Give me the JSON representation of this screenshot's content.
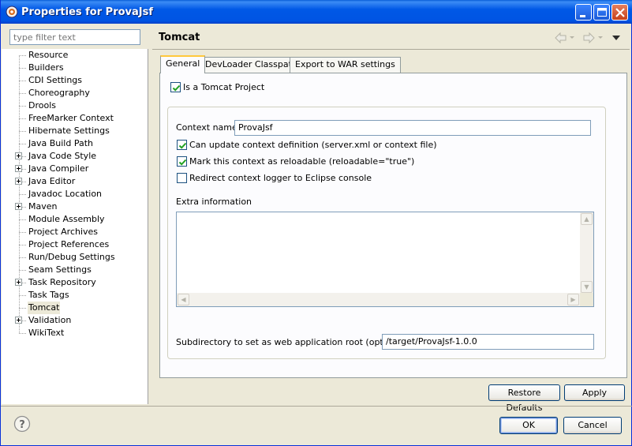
{
  "window": {
    "title": "Properties for ProvaJsf",
    "minimize_icon": "minimize-icon",
    "maximize_icon": "maximize-icon",
    "close_icon": "close-icon"
  },
  "filter": {
    "placeholder": "type filter text"
  },
  "tree": {
    "items": [
      {
        "label": "Resource",
        "expandable": false
      },
      {
        "label": "Builders",
        "expandable": false
      },
      {
        "label": "CDI Settings",
        "expandable": false
      },
      {
        "label": "Choreography",
        "expandable": false
      },
      {
        "label": "Drools",
        "expandable": false
      },
      {
        "label": "FreeMarker Context",
        "expandable": false
      },
      {
        "label": "Hibernate Settings",
        "expandable": false
      },
      {
        "label": "Java Build Path",
        "expandable": false
      },
      {
        "label": "Java Code Style",
        "expandable": true
      },
      {
        "label": "Java Compiler",
        "expandable": true
      },
      {
        "label": "Java Editor",
        "expandable": true
      },
      {
        "label": "Javadoc Location",
        "expandable": false
      },
      {
        "label": "Maven",
        "expandable": true
      },
      {
        "label": "Module Assembly",
        "expandable": false
      },
      {
        "label": "Project Archives",
        "expandable": false
      },
      {
        "label": "Project References",
        "expandable": false
      },
      {
        "label": "Run/Debug Settings",
        "expandable": false
      },
      {
        "label": "Seam Settings",
        "expandable": false
      },
      {
        "label": "Task Repository",
        "expandable": true
      },
      {
        "label": "Task Tags",
        "expandable": false
      },
      {
        "label": "Tomcat",
        "expandable": false,
        "selected": true
      },
      {
        "label": "Validation",
        "expandable": true
      },
      {
        "label": "WikiText",
        "expandable": false
      }
    ]
  },
  "page": {
    "title": "Tomcat",
    "nav_icons": [
      "back-arrow-icon",
      "forward-arrow-icon",
      "view-menu-icon"
    ]
  },
  "tabs": [
    {
      "label": "General",
      "active": true
    },
    {
      "label": "DevLoader Classpath",
      "active": false
    },
    {
      "label": "Export to WAR settings",
      "active": false
    }
  ],
  "general": {
    "is_tomcat_project": {
      "label": "Is a Tomcat Project",
      "checked": true
    },
    "context_name": {
      "label": "Context name",
      "value": "ProvaJsf"
    },
    "can_update": {
      "label": "Can update context definition (server.xml or context file)",
      "checked": true
    },
    "reloadable": {
      "label": "Mark this context as reloadable (reloadable=\"true\")",
      "checked": true
    },
    "redirect_logger": {
      "label": "Redirect context logger to Eclipse console",
      "checked": false
    },
    "extra_info": {
      "label": "Extra information",
      "value": ""
    },
    "subdirectory": {
      "label": "Subdirectory to set as web application root (optional)",
      "value": "/target/ProvaJsf-1.0.0"
    }
  },
  "buttons": {
    "restore_defaults": "Restore Defaults",
    "apply": "Apply",
    "ok": "OK",
    "cancel": "Cancel"
  },
  "colors": {
    "titlebar": "#0054e3",
    "dialog_bg": "#ece9d8",
    "tab_highlight": "#ffc83c",
    "checkmark": "#21a121"
  }
}
